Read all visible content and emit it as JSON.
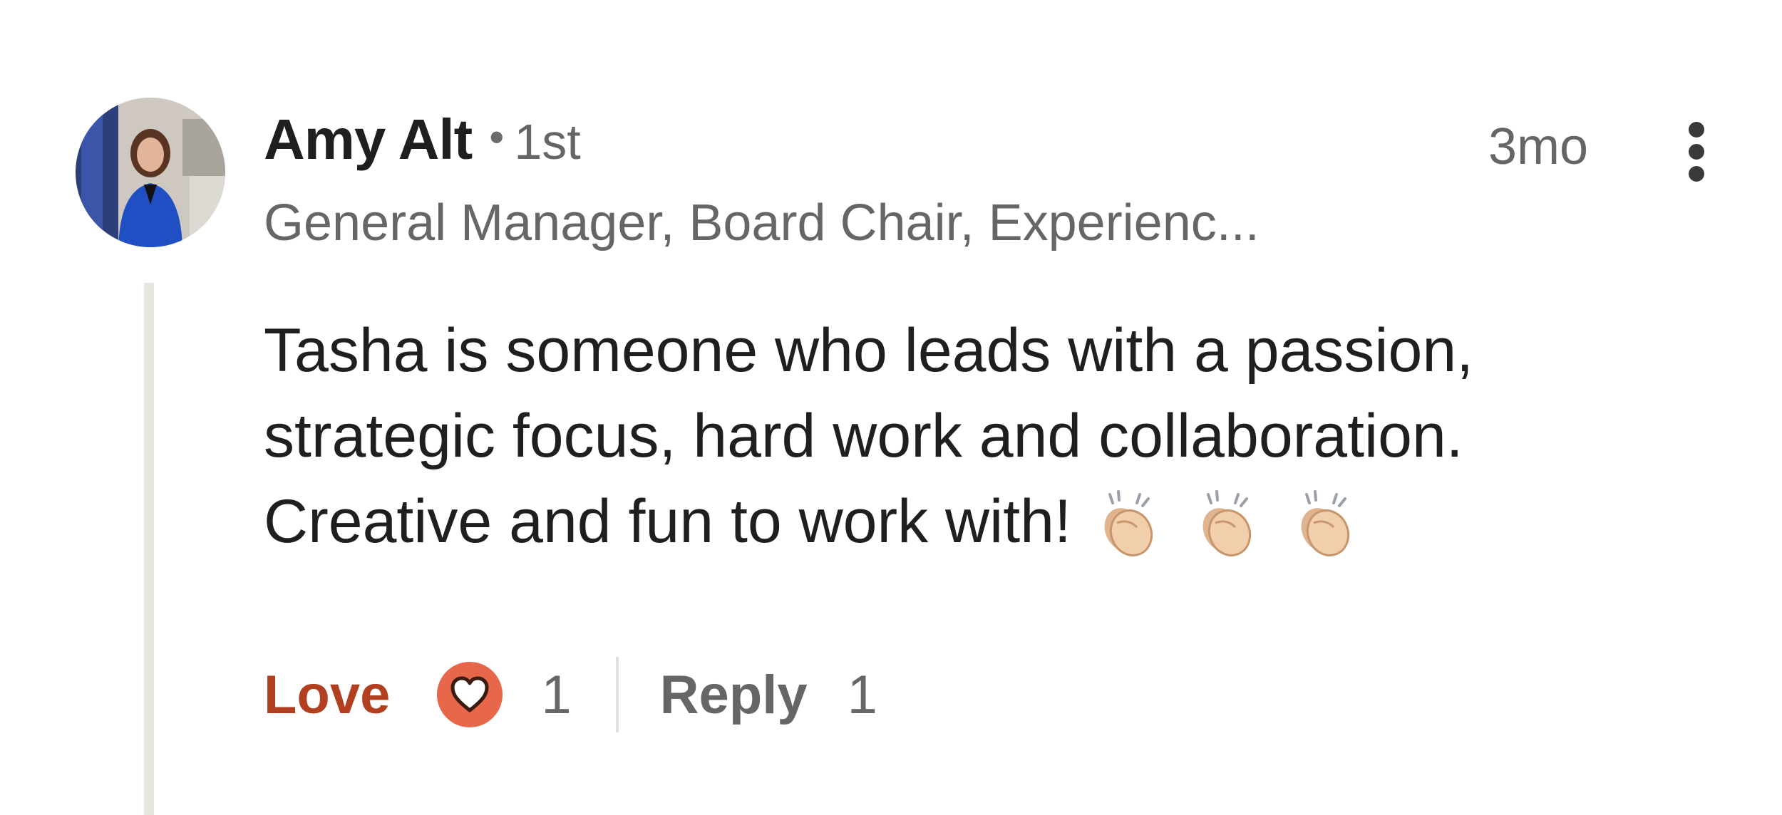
{
  "comment": {
    "author": {
      "name": "Amy Alt",
      "separator": "•",
      "connection_degree": "1st",
      "headline": "General Manager, Board Chair, Experienc...",
      "avatar_icon": "profile-photo"
    },
    "timestamp": "3mo",
    "more_icon": "more-vertical-icon",
    "text": "Tasha is someone who leads with a passion, strategic focus, hard work and collaboration. Creative and fun to work with!",
    "emoji": [
      "clapping-hands-icon",
      "clapping-hands-icon",
      "clapping-hands-icon"
    ],
    "actions": {
      "love_label": "Love",
      "reaction_icon": "heart-icon",
      "reaction_count": "1",
      "reply_label": "Reply",
      "reply_count": "1"
    }
  },
  "colors": {
    "love": "#b24020",
    "reaction_badge": "#e7674a",
    "muted_text": "#666666",
    "primary_text": "#1f1f1f",
    "thread_line": "#e8e6e1"
  }
}
